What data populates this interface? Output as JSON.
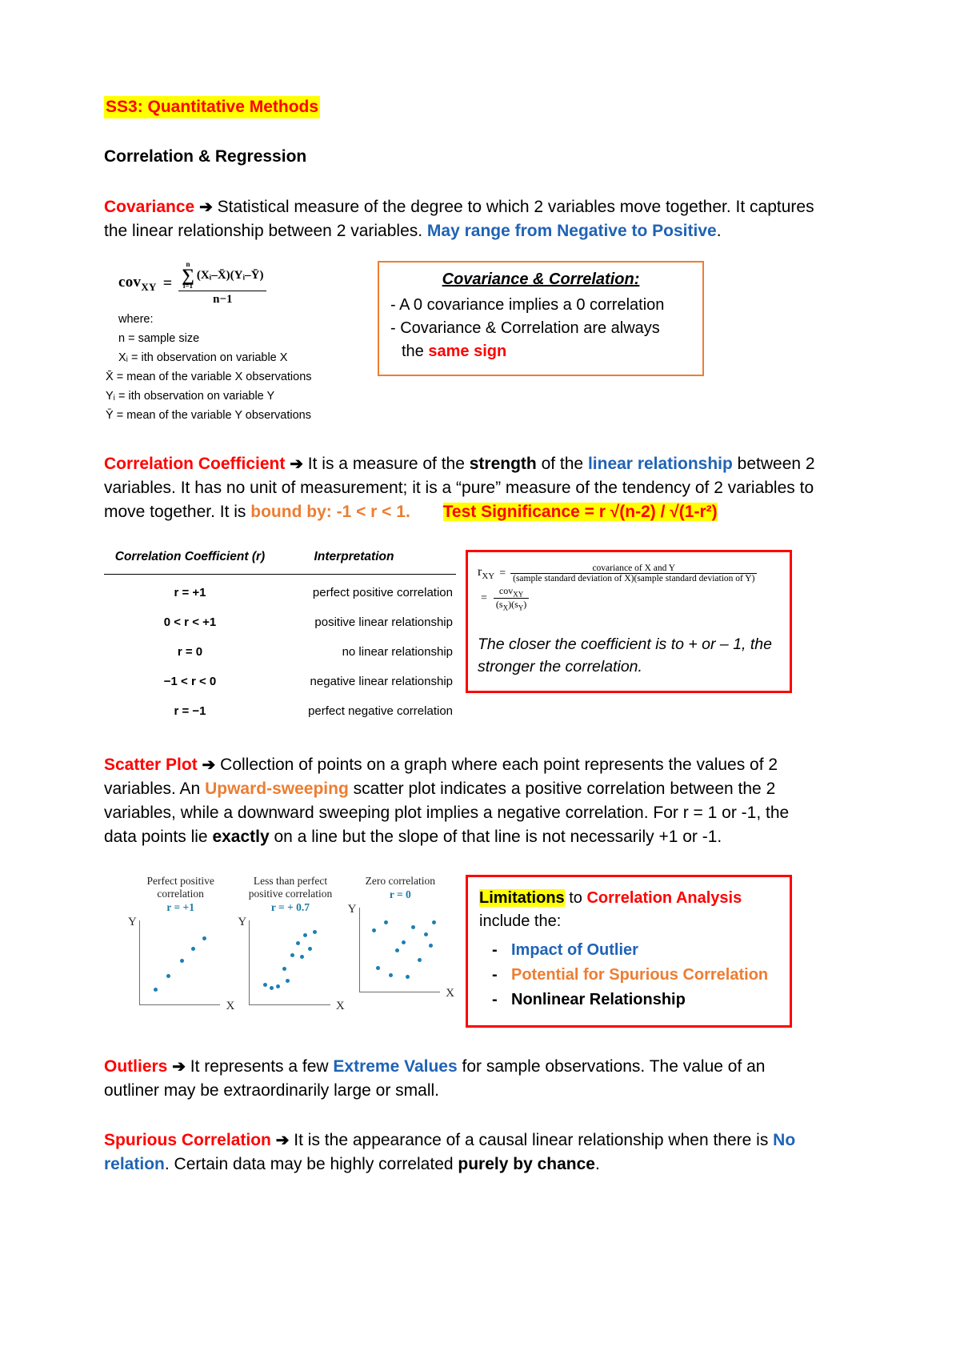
{
  "document": {
    "title": "SS3: Quantitative Methods",
    "subtitle": "Correlation & Regression"
  },
  "covariance": {
    "term": "Covariance",
    "arrow": "➔",
    "text_1": " Statistical measure of the degree to which 2 variables move together. It captures the linear relationship between 2 variables. ",
    "highlight_blue": "May range from Negative to Positive",
    "text_end": ".",
    "formula": {
      "lhs": "cov",
      "lhs_sub": "XY",
      "eq": "=",
      "sum_upper": "n",
      "sum_lower": "i=1",
      "numerator": "(Xᵢ–X̄)(Yᵢ–Ȳ)",
      "denominator": "n−1"
    },
    "where_label": "where:",
    "where_items": [
      "n = sample size",
      "Xᵢ = ith observation on variable X",
      "X̄ = mean of the variable X observations",
      "Yᵢ = ith observation on variable Y",
      "Ȳ = mean of the variable Y observations"
    ]
  },
  "orange_box": {
    "title": "Covariance & Correlation:",
    "line_1": "- A 0 covariance implies a 0 correlation",
    "line_2": "- Covariance & Correlation are always",
    "line_3_prefix": "the ",
    "line_3_red": "same sign"
  },
  "correlation_coefficient": {
    "term": "Correlation Coefficient",
    "arrow": "➔",
    "t1": " It is a measure of the ",
    "strength": "strength",
    "t2": " of the ",
    "linear_relationship": "linear relationship",
    "t3": " between 2 variables. It has no unit of measurement; it is a “pure” measure of the tendency of 2 variables to move together. It is ",
    "bound_by": "bound by: -1 < r < 1.",
    "test_significance": "Test Significance = r √(n-2) / √(1-r²)"
  },
  "corr_table": {
    "headers": [
      "Correlation Coefficient (r)",
      "Interpretation"
    ],
    "rows": [
      {
        "r": "r = +1",
        "interpretation": "perfect positive correlation"
      },
      {
        "r": "0 < r < +1",
        "interpretation": "positive linear relationship"
      },
      {
        "r": "r = 0",
        "interpretation": "no linear relationship"
      },
      {
        "r": "−1 < r < 0",
        "interpretation": "negative linear relationship"
      },
      {
        "r": "r = −1",
        "interpretation": "perfect negative correlation"
      }
    ]
  },
  "red_box_r": {
    "lhs": "r",
    "lhs_sub": "XY",
    "numerator": "covariance of X and Y",
    "denominator": "(sample standard deviation of X)(sample standard deviation of Y)",
    "second_num": "cov",
    "second_num_sub": "XY",
    "second_den_a": "(s",
    "second_den_a_sub": "X",
    "second_den_b": ")(s",
    "second_den_b_sub": "Y",
    "second_den_c": ")",
    "note": "The closer the coefficient is to + or – 1, the stronger the correlation."
  },
  "scatter_plot": {
    "term": "Scatter Plot",
    "arrow": "➔",
    "t1": " Collection of points on a graph where each point represents the values of 2 variables. An ",
    "upward": "Upward-sweeping",
    "t2": " scatter plot indicates a positive correlation between the 2 variables, while a downward sweeping plot implies a negative correlation. For r = 1 or -1, the data points lie ",
    "exactly": "exactly",
    "t3": " on a line but the slope of that line is not necessarily +1 or -1."
  },
  "chart_data": [
    {
      "type": "scatter",
      "title": "Perfect positive correlation",
      "annotation": "r = +1",
      "xlabel": "X",
      "ylabel": "Y",
      "points": [
        [
          0.14,
          0.18
        ],
        [
          0.3,
          0.36
        ],
        [
          0.47,
          0.55
        ],
        [
          0.62,
          0.7
        ],
        [
          0.76,
          0.84
        ]
      ]
    },
    {
      "type": "scatter",
      "title": "Less than perfect positive correlation",
      "annotation": "r = + 0.7",
      "xlabel": "X",
      "ylabel": "Y",
      "points": [
        [
          0.14,
          0.24
        ],
        [
          0.22,
          0.2
        ],
        [
          0.3,
          0.22
        ],
        [
          0.38,
          0.45
        ],
        [
          0.42,
          0.3
        ],
        [
          0.48,
          0.62
        ],
        [
          0.55,
          0.78
        ],
        [
          0.6,
          0.6
        ],
        [
          0.64,
          0.88
        ],
        [
          0.7,
          0.7
        ],
        [
          0.76,
          0.92
        ]
      ]
    },
    {
      "type": "scatter",
      "title": "Zero correlation",
      "annotation": "r = 0",
      "xlabel": "X",
      "ylabel": "Y",
      "points": [
        [
          0.12,
          0.78
        ],
        [
          0.18,
          0.3
        ],
        [
          0.28,
          0.88
        ],
        [
          0.34,
          0.2
        ],
        [
          0.42,
          0.52
        ],
        [
          0.5,
          0.62
        ],
        [
          0.55,
          0.18
        ],
        [
          0.62,
          0.82
        ],
        [
          0.7,
          0.4
        ],
        [
          0.78,
          0.72
        ],
        [
          0.84,
          0.58
        ],
        [
          0.88,
          0.88
        ]
      ]
    }
  ],
  "limitations_box": {
    "highlight": "Limitations",
    "mid": " to ",
    "red": "Correlation Analysis",
    "tail": " include the:",
    "items": [
      {
        "label": "Impact of Outlier",
        "color": "blue"
      },
      {
        "label": "Potential for Spurious Correlation",
        "color": "orange"
      },
      {
        "label": "Nonlinear Relationship",
        "color": "black"
      }
    ]
  },
  "outliers": {
    "term": "Outliers",
    "arrow": "➔",
    "t1": " It represents a few ",
    "extreme": "Extreme Values",
    "t2": " for sample observations. The value of an outliner may be extraordinarily large or small."
  },
  "spurious": {
    "term": "Spurious Correlation",
    "arrow": "➔",
    "t1": " It is the appearance of a causal linear relationship when there is ",
    "no_relation": "No relation",
    "t2": ". Certain data may be highly correlated ",
    "purely": "purely by chance",
    "t3": "."
  },
  "colors": {
    "red": "#ff0000",
    "blue": "#1f63b5",
    "orange": "#ed7d31",
    "highlight": "#ffff00",
    "scatter_point": "#1b7fb5"
  }
}
